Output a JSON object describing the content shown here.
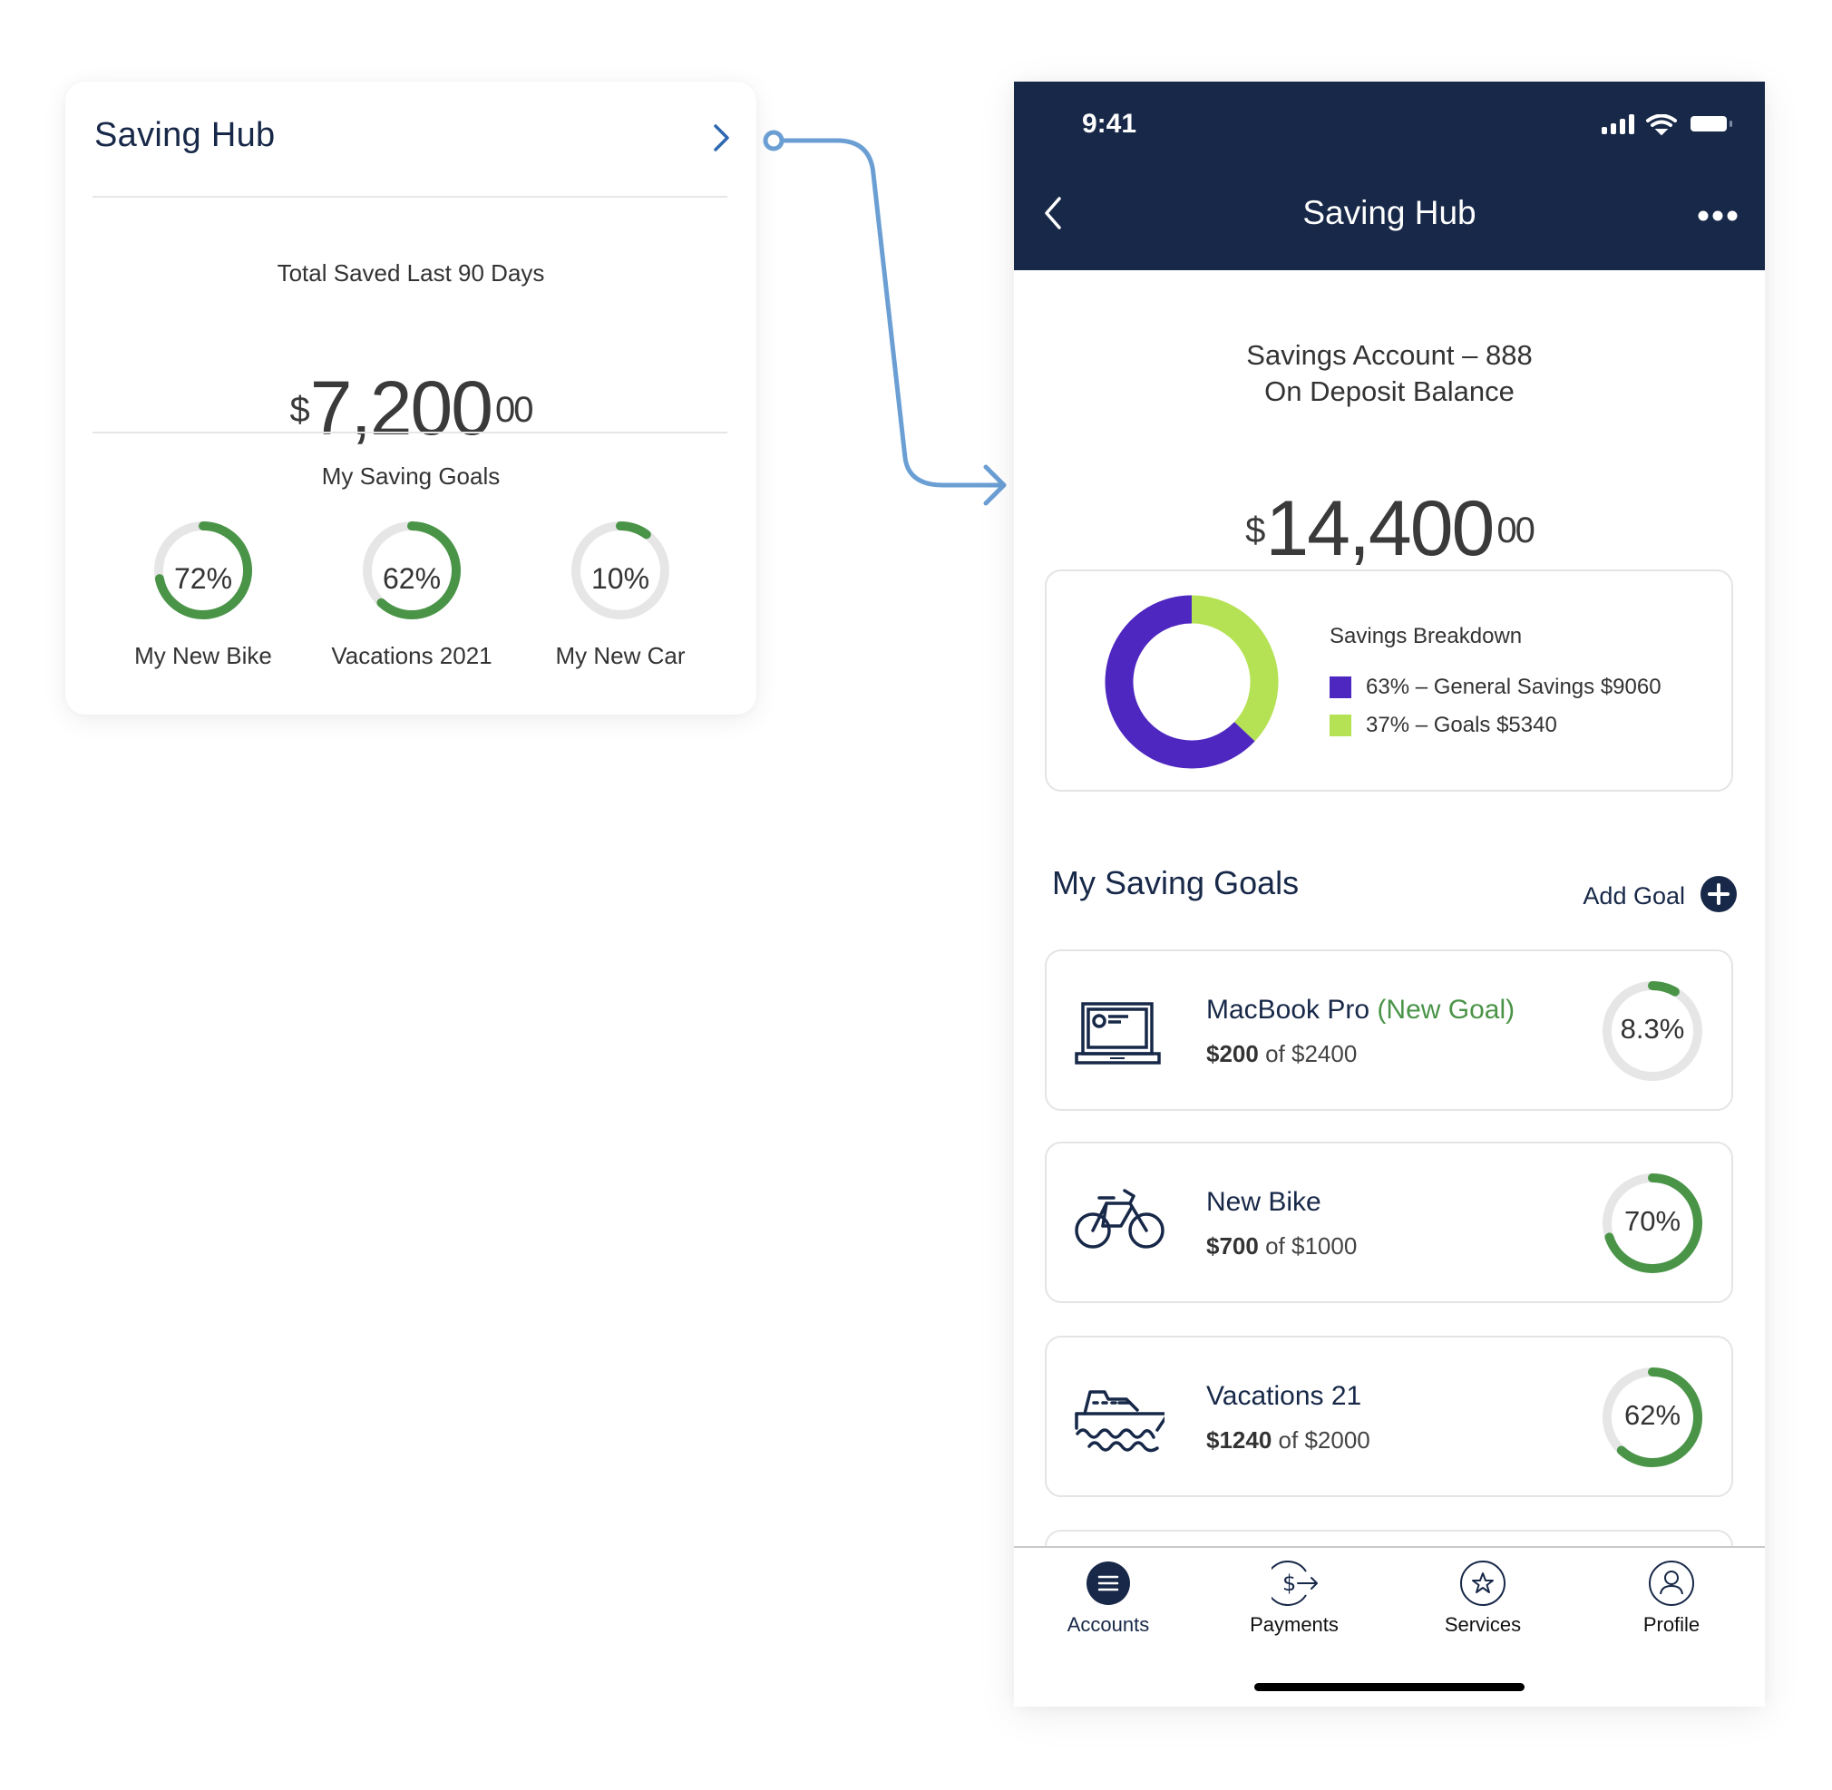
{
  "widget": {
    "title": "Saving Hub",
    "open_icon": "chevron-right-icon",
    "total_caption": "Total Saved Last 90 Days",
    "total": {
      "currency": "$",
      "whole": "7,200",
      "cents": "00"
    },
    "goals_caption": "My Saving Goals",
    "goals": [
      {
        "label": "My New Bike",
        "percent_text": "72%",
        "progress": 0.72
      },
      {
        "label": "Vacations 2021",
        "percent_text": "62%",
        "progress": 0.62
      },
      {
        "label": "My New Car",
        "percent_text": "10%",
        "progress": 0.1
      }
    ]
  },
  "phone": {
    "status_bar": {
      "time": "9:41",
      "icons": [
        "signal-icon",
        "wifi-icon",
        "battery-icon"
      ]
    },
    "nav": {
      "back_icon": "chevron-left-icon",
      "title": "Saving Hub",
      "more_icon": "more-horizontal-icon"
    },
    "account": {
      "name": "Savings Account – 888",
      "balance_label": "On Deposit Balance",
      "balance": {
        "currency": "$",
        "whole": "14,400",
        "cents": "00"
      }
    },
    "breakdown": {
      "title": "Savings Breakdown"
    },
    "goals_section": {
      "title": "My Saving Goals",
      "add_label": "Add Goal",
      "add_icon": "plus-circle-icon",
      "items": [
        {
          "icon": "laptop-icon",
          "name": "MacBook Pro",
          "badge": "(New Goal)",
          "saved": "$200",
          "of": "of",
          "target": "$2400",
          "percent_text": "8.3%",
          "progress": 0.083
        },
        {
          "icon": "bicycle-icon",
          "name": "New Bike",
          "badge": "",
          "saved": "$700",
          "of": "of",
          "target": "$1000",
          "percent_text": "70%",
          "progress": 0.7
        },
        {
          "icon": "ship-icon",
          "name": "Vacations 21",
          "badge": "",
          "saved": "$1240",
          "of": "of",
          "target": "$2000",
          "percent_text": "62%",
          "progress": 0.62
        }
      ]
    },
    "tabbar": [
      {
        "label": "Accounts",
        "icon": "menu-icon",
        "active": true
      },
      {
        "label": "Payments",
        "icon": "dollar-send-icon",
        "active": false
      },
      {
        "label": "Services",
        "icon": "star-icon",
        "active": false
      },
      {
        "label": "Profile",
        "icon": "user-icon",
        "active": false
      }
    ]
  },
  "colors": {
    "navy": "#172848",
    "progress_green": "#4a9448",
    "track_gray": "#e6e6e6",
    "connector_blue": "#6b9fd4",
    "general_savings_purple": "#4e27c0",
    "goals_lime": "#b5e255",
    "badge_green": "#4a9448"
  },
  "chart_data": {
    "type": "pie",
    "title": "Savings Breakdown",
    "donut": true,
    "legend_position": "right",
    "series": [
      {
        "name": "General Savings",
        "percent": 63,
        "value": 9060,
        "label": "63% – General Savings $9060",
        "color": "#4e27c0"
      },
      {
        "name": "Goals",
        "percent": 37,
        "value": 5340,
        "label": "37% – Goals $5340",
        "color": "#b5e255"
      }
    ]
  }
}
